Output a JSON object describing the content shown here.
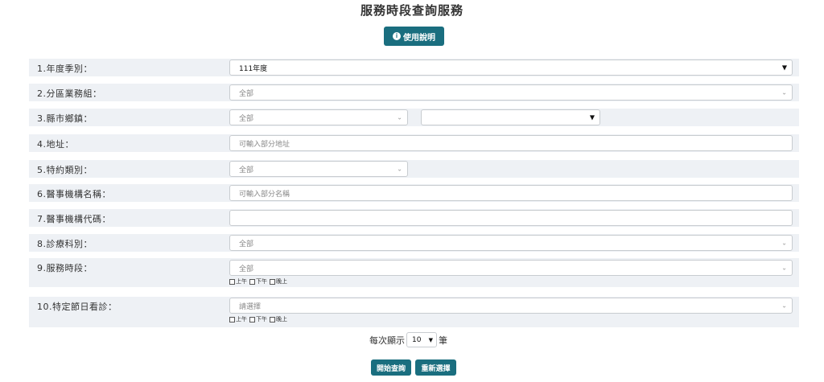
{
  "page": {
    "title": "服務時段查詢服務",
    "help_label": "使用說明"
  },
  "form": {
    "rows": [
      {
        "label": "1.年度季別：",
        "value": "111年度"
      },
      {
        "label": "2.分區業務組：",
        "value": "全部"
      },
      {
        "label": "3.縣市鄉鎮：",
        "value": "全部",
        "value2": ""
      },
      {
        "label": "4.地址：",
        "placeholder": "可輸入部分地址"
      },
      {
        "label": "5.特約類別：",
        "value": "全部"
      },
      {
        "label": "6.醫事機構名稱：",
        "placeholder": "可輸入部分名稱"
      },
      {
        "label": "7.醫事機構代碼：",
        "value": ""
      },
      {
        "label": "8.診療科別：",
        "value": "全部"
      },
      {
        "label": "9.服務時段：",
        "value": "全部",
        "checks": [
          "上午",
          "下午",
          "晚上"
        ]
      },
      {
        "label": "10.特定節日看診：",
        "value": "請選擇",
        "checks": [
          "上午",
          "下午",
          "晚上"
        ]
      }
    ]
  },
  "pagination": {
    "prefix": "每次顯示",
    "value": "10",
    "suffix": "筆"
  },
  "actions": {
    "search_label": "開始查詢",
    "reset_label": "重新選擇"
  },
  "colors": {
    "accent": "#1a6e7f",
    "row_bg": "#eef1f5"
  }
}
